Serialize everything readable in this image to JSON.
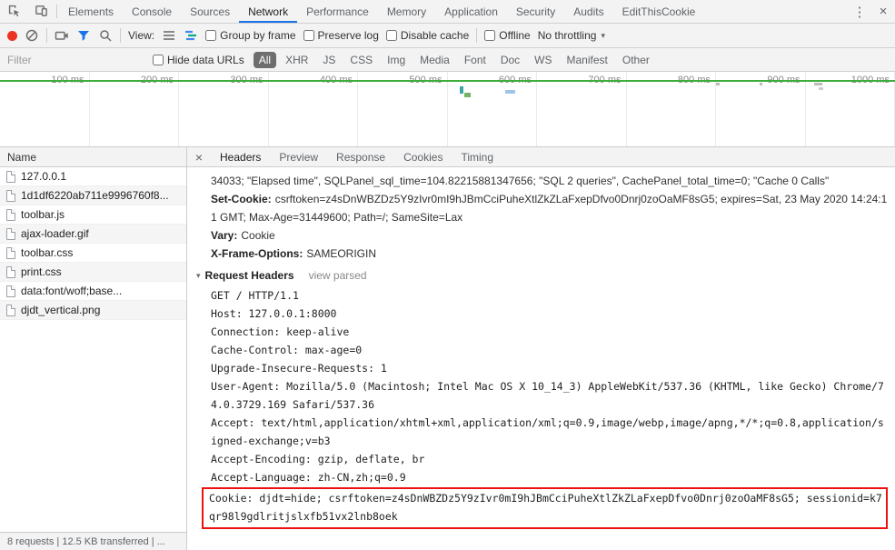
{
  "colors": {
    "accent": "#1a73e8",
    "record": "#ea3323",
    "annotation": "#ee1111",
    "timeline_green": "#3dae3d"
  },
  "icons": {
    "menu": "⋮",
    "close": "×",
    "disclosure": "▾",
    "dropdown": "▾"
  },
  "tabbar": {
    "tabs": [
      "Elements",
      "Console",
      "Sources",
      "Network",
      "Performance",
      "Memory",
      "Application",
      "Security",
      "Audits",
      "EditThisCookie"
    ],
    "active": "Network"
  },
  "toolbar": {
    "view_label": "View:",
    "group_by_frame": "Group by frame",
    "preserve_log": "Preserve log",
    "disable_cache": "Disable cache",
    "offline": "Offline",
    "throttling": "No throttling"
  },
  "filterbar": {
    "placeholder": "Filter",
    "hide_data_urls": "Hide data URLs",
    "types": [
      "All",
      "XHR",
      "JS",
      "CSS",
      "Img",
      "Media",
      "Font",
      "Doc",
      "WS",
      "Manifest",
      "Other"
    ],
    "active_type": "All"
  },
  "overview": {
    "ticks": [
      "100 ms",
      "200 ms",
      "300 ms",
      "400 ms",
      "500 ms",
      "600 ms",
      "700 ms",
      "800 ms",
      "900 ms",
      "1000 ms"
    ]
  },
  "requests": {
    "header": "Name",
    "items": [
      {
        "name": "127.0.0.1",
        "type": "document"
      },
      {
        "name": "1d1df6220ab711e9996760f8...",
        "type": "script"
      },
      {
        "name": "toolbar.js",
        "type": "script"
      },
      {
        "name": "ajax-loader.gif",
        "type": "image"
      },
      {
        "name": "toolbar.css",
        "type": "stylesheet"
      },
      {
        "name": "print.css",
        "type": "stylesheet"
      },
      {
        "name": "data:font/woff;base...",
        "type": "font"
      },
      {
        "name": "djdt_vertical.png",
        "type": "image"
      }
    ]
  },
  "details": {
    "tabs": [
      "Headers",
      "Preview",
      "Response",
      "Cookies",
      "Timing"
    ],
    "active_tab": "Headers",
    "response_overflow": "34033; \"Elapsed time\", SQLPanel_sql_time=104.82215881347656; \"SQL 2 queries\", CachePanel_total_time=0; \"Cache 0 Calls\"",
    "response_headers": [
      {
        "name": "Set-Cookie:",
        "value": "csrftoken=z4sDnWBZDz5Y9zIvr0mI9hJBmCciPuheXtlZkZLaFxepDfvo0Dnrj0zoOaMF8sG5; expires=Sat, 23 May 2020 14:24:11 GMT; Max-Age=31449600; Path=/; SameSite=Lax"
      },
      {
        "name": "Vary:",
        "value": "Cookie"
      },
      {
        "name": "X-Frame-Options:",
        "value": "SAMEORIGIN"
      }
    ],
    "request_section": {
      "title": "Request Headers",
      "toggle": "view parsed"
    },
    "request_source": [
      "GET / HTTP/1.1",
      "Host: 127.0.0.1:8000",
      "Connection: keep-alive",
      "Cache-Control: max-age=0",
      "Upgrade-Insecure-Requests: 1",
      "User-Agent: Mozilla/5.0 (Macintosh; Intel Mac OS X 10_14_3) AppleWebKit/537.36 (KHTML, like Gecko) Chrome/74.0.3729.169 Safari/537.36",
      "Accept: text/html,application/xhtml+xml,application/xml;q=0.9,image/webp,image/apng,*/*;q=0.8,application/signed-exchange;v=b3",
      "Accept-Encoding: gzip, deflate, br",
      "Accept-Language: zh-CN,zh;q=0.9"
    ],
    "cookie_line": "Cookie: djdt=hide; csrftoken=z4sDnWBZDz5Y9zIvr0mI9hJBmCciPuheXtlZkZLaFxepDfvo0Dnrj0zoOaMF8sG5; sessionid=k7qr98l9gdlritjslxfb51vx2lnb8oek"
  },
  "statusbar": {
    "summary": "8 requests | 12.5 KB transferred | ..."
  }
}
